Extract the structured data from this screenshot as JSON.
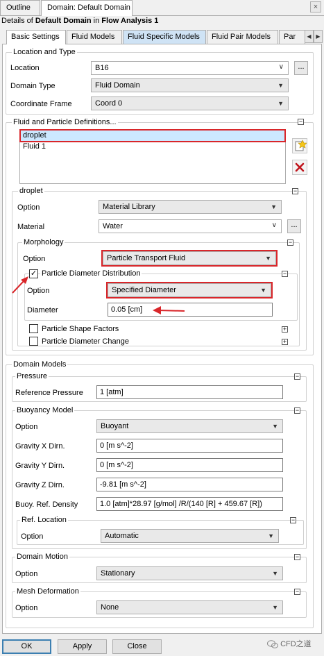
{
  "tabs": {
    "outline": "Outline",
    "domain": "Domain: Default Domain"
  },
  "header": {
    "prefix": "Details of ",
    "domain": "Default Domain",
    "mid": " in ",
    "analysis": "Flow Analysis 1"
  },
  "subtabs": [
    "Basic Settings",
    "Fluid Models",
    "Fluid Specific Models",
    "Fluid Pair Models",
    "Par"
  ],
  "location_and_type": {
    "title": "Location and Type",
    "location_label": "Location",
    "location_value": "B16",
    "domain_type_label": "Domain Type",
    "domain_type_value": "Fluid Domain",
    "coord_label": "Coordinate Frame",
    "coord_value": "Coord 0"
  },
  "fluid_defs": {
    "title": "Fluid and Particle Definitions...",
    "items": [
      "droplet",
      "Fluid 1"
    ]
  },
  "droplet": {
    "title": "droplet",
    "option_label": "Option",
    "option_value": "Material Library",
    "material_label": "Material",
    "material_value": "Water",
    "morphology": {
      "title": "Morphology",
      "option_label": "Option",
      "option_value": "Particle Transport Fluid",
      "pdd_label": "Particle Diameter Distribution",
      "pdd_option_label": "Option",
      "pdd_option_value": "Specified Diameter",
      "diameter_label": "Diameter",
      "diameter_value": "0.05 [cm]",
      "shape_label": "Particle Shape Factors",
      "change_label": "Particle Diameter Change"
    }
  },
  "domain_models": {
    "title": "Domain Models",
    "pressure": {
      "title": "Pressure",
      "ref_label": "Reference Pressure",
      "ref_value": "1 [atm]"
    },
    "buoyancy": {
      "title": "Buoyancy Model",
      "option_label": "Option",
      "option_value": "Buoyant",
      "gx_label": "Gravity X Dirn.",
      "gx_value": "0 [m s^-2]",
      "gy_label": "Gravity Y Dirn.",
      "gy_value": "0 [m s^-2]",
      "gz_label": "Gravity Z Dirn.",
      "gz_value": "-9.81 [m s^-2]",
      "density_label": "Buoy. Ref. Density",
      "density_value": "1.0 [atm]*28.97 [g/mol] /R/(140 [R] + 459.67 [R])",
      "ref_location": {
        "title": "Ref. Location",
        "option_label": "Option",
        "option_value": "Automatic"
      }
    },
    "motion": {
      "title": "Domain Motion",
      "option_label": "Option",
      "option_value": "Stationary"
    },
    "mesh": {
      "title": "Mesh Deformation",
      "option_label": "Option",
      "option_value": "None"
    }
  },
  "buttons": {
    "ok": "OK",
    "apply": "Apply",
    "close": "Close"
  },
  "watermark": "CFD之道",
  "glyphs": {
    "close": "×",
    "dots": "...",
    "minus": "−",
    "plus": "+",
    "check": "✓",
    "combo_arrow": "▼",
    "edit_arrow": "∨",
    "left": "◀",
    "right": "▶"
  },
  "colors": {
    "highlight": "#d9262a",
    "selection": "#cce8ff",
    "tab_highlight": "#cfe3f5"
  }
}
